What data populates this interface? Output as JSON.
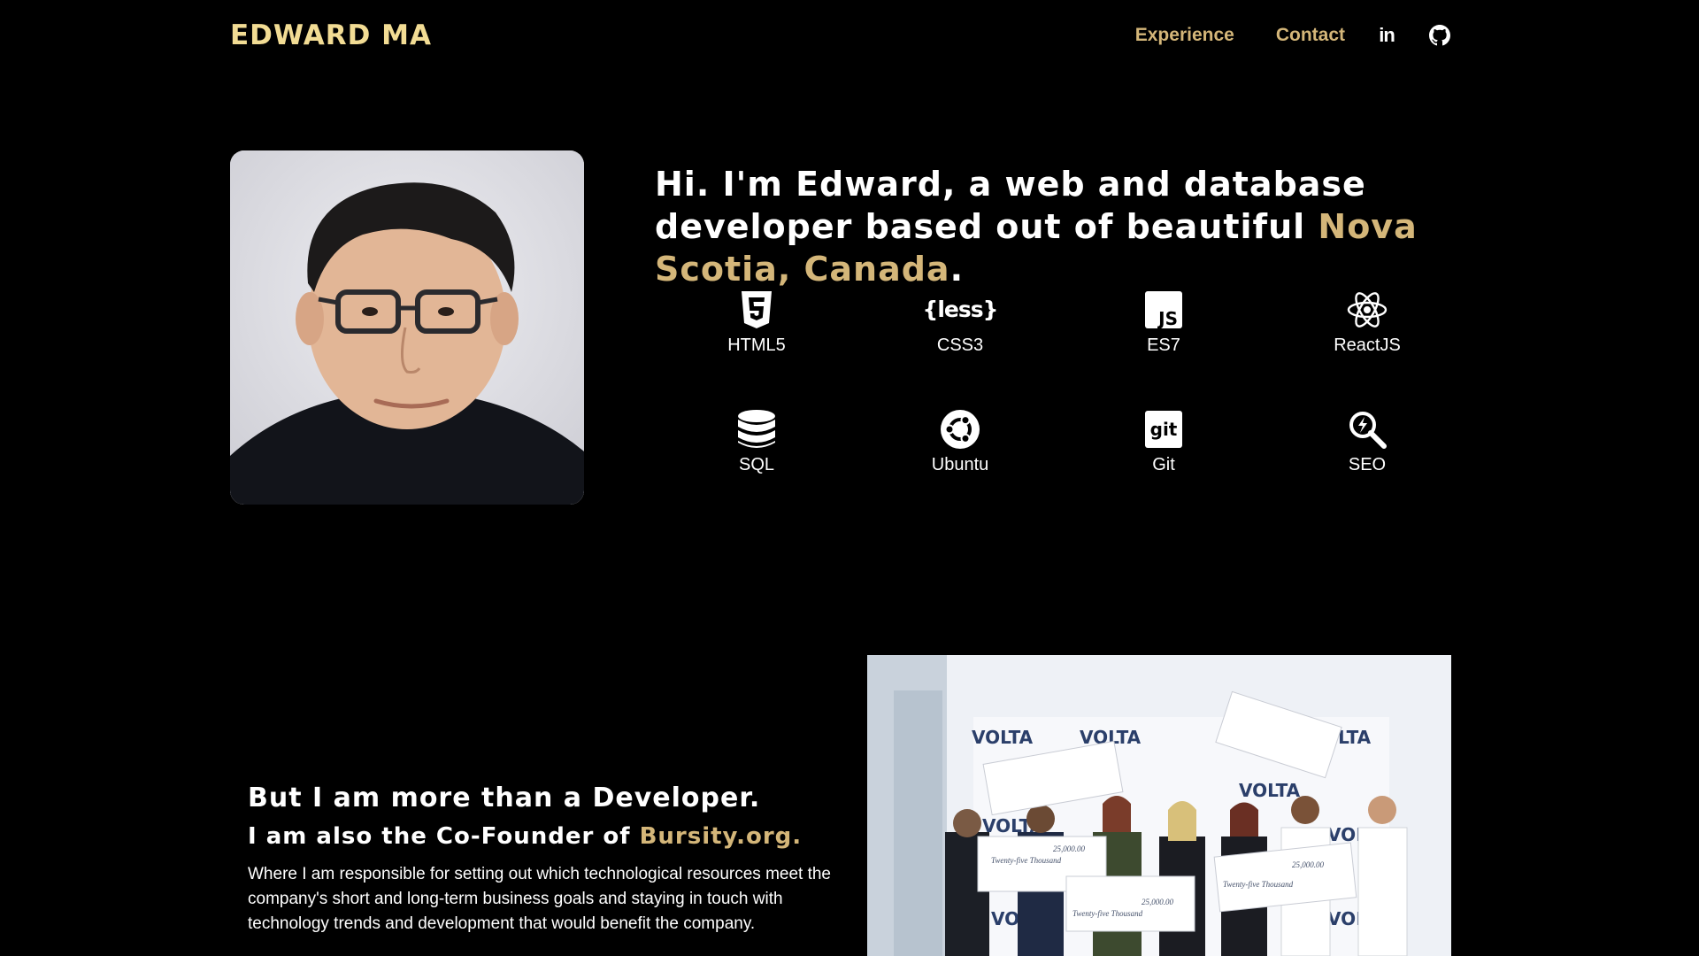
{
  "header": {
    "logo": "EDWARD MA",
    "nav": [
      {
        "label": "Experience"
      },
      {
        "label": "Contact"
      }
    ],
    "social": [
      {
        "icon": "linkedin-icon",
        "glyph": "in"
      },
      {
        "icon": "github-icon"
      }
    ]
  },
  "hero": {
    "intro": "Hi. I'm Edward, a web and database developer based out of beautiful ",
    "location": "Nova Scotia, Canada",
    "end": ".",
    "skills": [
      {
        "label": "HTML5",
        "icon": "html5-icon"
      },
      {
        "label": "CSS3",
        "icon": "less-icon"
      },
      {
        "label": "ES7",
        "icon": "javascript-icon"
      },
      {
        "label": "ReactJS",
        "icon": "react-icon"
      },
      {
        "label": "SQL",
        "icon": "database-icon"
      },
      {
        "label": "Ubuntu",
        "icon": "ubuntu-icon"
      },
      {
        "label": "Git",
        "icon": "git-icon"
      },
      {
        "label": "SEO",
        "icon": "seo-search-icon"
      }
    ],
    "less_logo_text": "{less}",
    "js_logo_text": "JS",
    "git_logo_text": "git"
  },
  "about": {
    "heading": "But I am more than a Developer.",
    "cofounder_prefix": "I am also the Co-Founder of ",
    "cofounder_link": "Bursity.org",
    "cofounder_suffix": ".",
    "description": "Where I am responsible for setting out which technological resources meet the company's short and long-term business goals and staying in touch with technology trends and development that would benefit the company."
  },
  "photo": {
    "banner_word": "VOLTA",
    "cheque_amount": "25,000.00",
    "cheque_words": "Twenty-five Thousand"
  },
  "colors": {
    "background": "#000000",
    "accent": "#d4b679",
    "logo": "#f2dc94",
    "text": "#ffffff"
  }
}
